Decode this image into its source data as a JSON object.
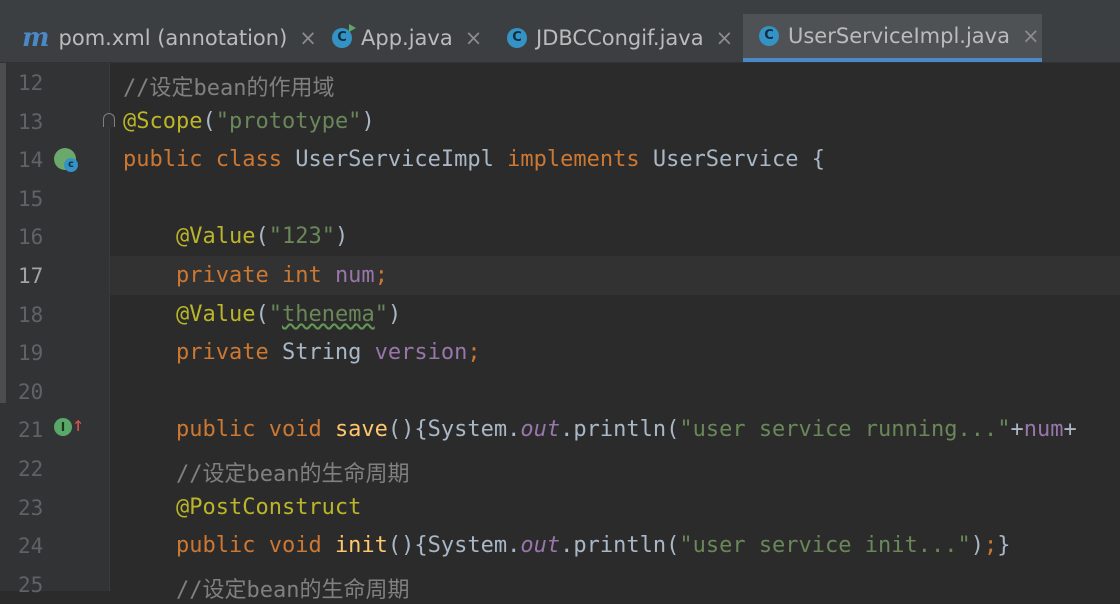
{
  "tabs": [
    {
      "label": "pom.xml (annotation)",
      "icon": "maven-icon",
      "icon_glyph": "m",
      "close": "×",
      "active": false
    },
    {
      "label": "App.java",
      "icon": "class-run-icon",
      "icon_glyph": "C",
      "close": "×",
      "active": false
    },
    {
      "label": "JDBCCongif.java",
      "icon": "class-icon",
      "icon_glyph": "C",
      "close": "×",
      "active": false
    },
    {
      "label": "UserServiceImpl.java",
      "icon": "class-icon",
      "icon_glyph": "C",
      "close": "×",
      "active": true
    }
  ],
  "gutter_icons": {
    "bean_letter": "c",
    "impl_letter": "I",
    "impl_arrow": "↑"
  },
  "lines": [
    {
      "num": "12",
      "tokens": [
        {
          "t": "//设定bean的作用域",
          "c": "cmt"
        }
      ]
    },
    {
      "num": "13",
      "tokens": [
        {
          "t": "@Scope",
          "c": "ann"
        },
        {
          "t": "(",
          "c": ""
        },
        {
          "t": "\"prototype\"",
          "c": "str"
        },
        {
          "t": ")",
          "c": ""
        }
      ]
    },
    {
      "num": "14",
      "tokens": [
        {
          "t": "public ",
          "c": "kw"
        },
        {
          "t": "class ",
          "c": "kw"
        },
        {
          "t": "UserServiceImpl ",
          "c": ""
        },
        {
          "t": "implements ",
          "c": "kw"
        },
        {
          "t": "UserService {",
          "c": ""
        }
      ]
    },
    {
      "num": "15",
      "tokens": []
    },
    {
      "num": "16",
      "tokens": [
        {
          "t": "    ",
          "c": ""
        },
        {
          "t": "@Value",
          "c": "ann"
        },
        {
          "t": "(",
          "c": ""
        },
        {
          "t": "\"123\"",
          "c": "str"
        },
        {
          "t": ")",
          "c": ""
        }
      ]
    },
    {
      "num": "17",
      "tokens": [
        {
          "t": "    ",
          "c": ""
        },
        {
          "t": "private ",
          "c": "kw"
        },
        {
          "t": "int ",
          "c": "kw"
        },
        {
          "t": "num",
          "c": "fld"
        },
        {
          "t": ";",
          "c": "kw"
        }
      ]
    },
    {
      "num": "18",
      "tokens": [
        {
          "t": "    ",
          "c": ""
        },
        {
          "t": "@Value",
          "c": "ann"
        },
        {
          "t": "(",
          "c": ""
        },
        {
          "t": "\"",
          "c": "str"
        },
        {
          "t": "thenema",
          "c": "str typo"
        },
        {
          "t": "\"",
          "c": "str"
        },
        {
          "t": ")",
          "c": ""
        }
      ]
    },
    {
      "num": "19",
      "tokens": [
        {
          "t": "    ",
          "c": ""
        },
        {
          "t": "private ",
          "c": "kw"
        },
        {
          "t": "String ",
          "c": ""
        },
        {
          "t": "version",
          "c": "fld"
        },
        {
          "t": ";",
          "c": "kw"
        }
      ]
    },
    {
      "num": "20",
      "tokens": []
    },
    {
      "num": "21",
      "tokens": [
        {
          "t": "    ",
          "c": ""
        },
        {
          "t": "public ",
          "c": "kw"
        },
        {
          "t": "void ",
          "c": "kw"
        },
        {
          "t": "save",
          "c": "fn"
        },
        {
          "t": "(){System.",
          "c": ""
        },
        {
          "t": "out",
          "c": "st"
        },
        {
          "t": ".println(",
          "c": ""
        },
        {
          "t": "\"user service running...\"",
          "c": "str"
        },
        {
          "t": "+",
          "c": ""
        },
        {
          "t": "num",
          "c": "fld"
        },
        {
          "t": "+",
          "c": ""
        }
      ]
    },
    {
      "num": "22",
      "tokens": [
        {
          "t": "    ",
          "c": ""
        },
        {
          "t": "//设定bean的生命周期",
          "c": "cmt"
        }
      ]
    },
    {
      "num": "23",
      "tokens": [
        {
          "t": "    ",
          "c": ""
        },
        {
          "t": "@PostConstruct",
          "c": "ann"
        }
      ]
    },
    {
      "num": "24",
      "tokens": [
        {
          "t": "    ",
          "c": ""
        },
        {
          "t": "public ",
          "c": "kw"
        },
        {
          "t": "void ",
          "c": "kw"
        },
        {
          "t": "init",
          "c": "fn"
        },
        {
          "t": "(){System.",
          "c": ""
        },
        {
          "t": "out",
          "c": "st"
        },
        {
          "t": ".println(",
          "c": ""
        },
        {
          "t": "\"user service init...\"",
          "c": "str"
        },
        {
          "t": ")",
          "c": ""
        },
        {
          "t": ";",
          "c": "kw"
        },
        {
          "t": "}",
          "c": ""
        }
      ]
    },
    {
      "num": "25",
      "tokens": [
        {
          "t": "    ",
          "c": ""
        },
        {
          "t": "//设定bean的生命周期",
          "c": "cmt"
        }
      ]
    }
  ],
  "current_line": "17"
}
